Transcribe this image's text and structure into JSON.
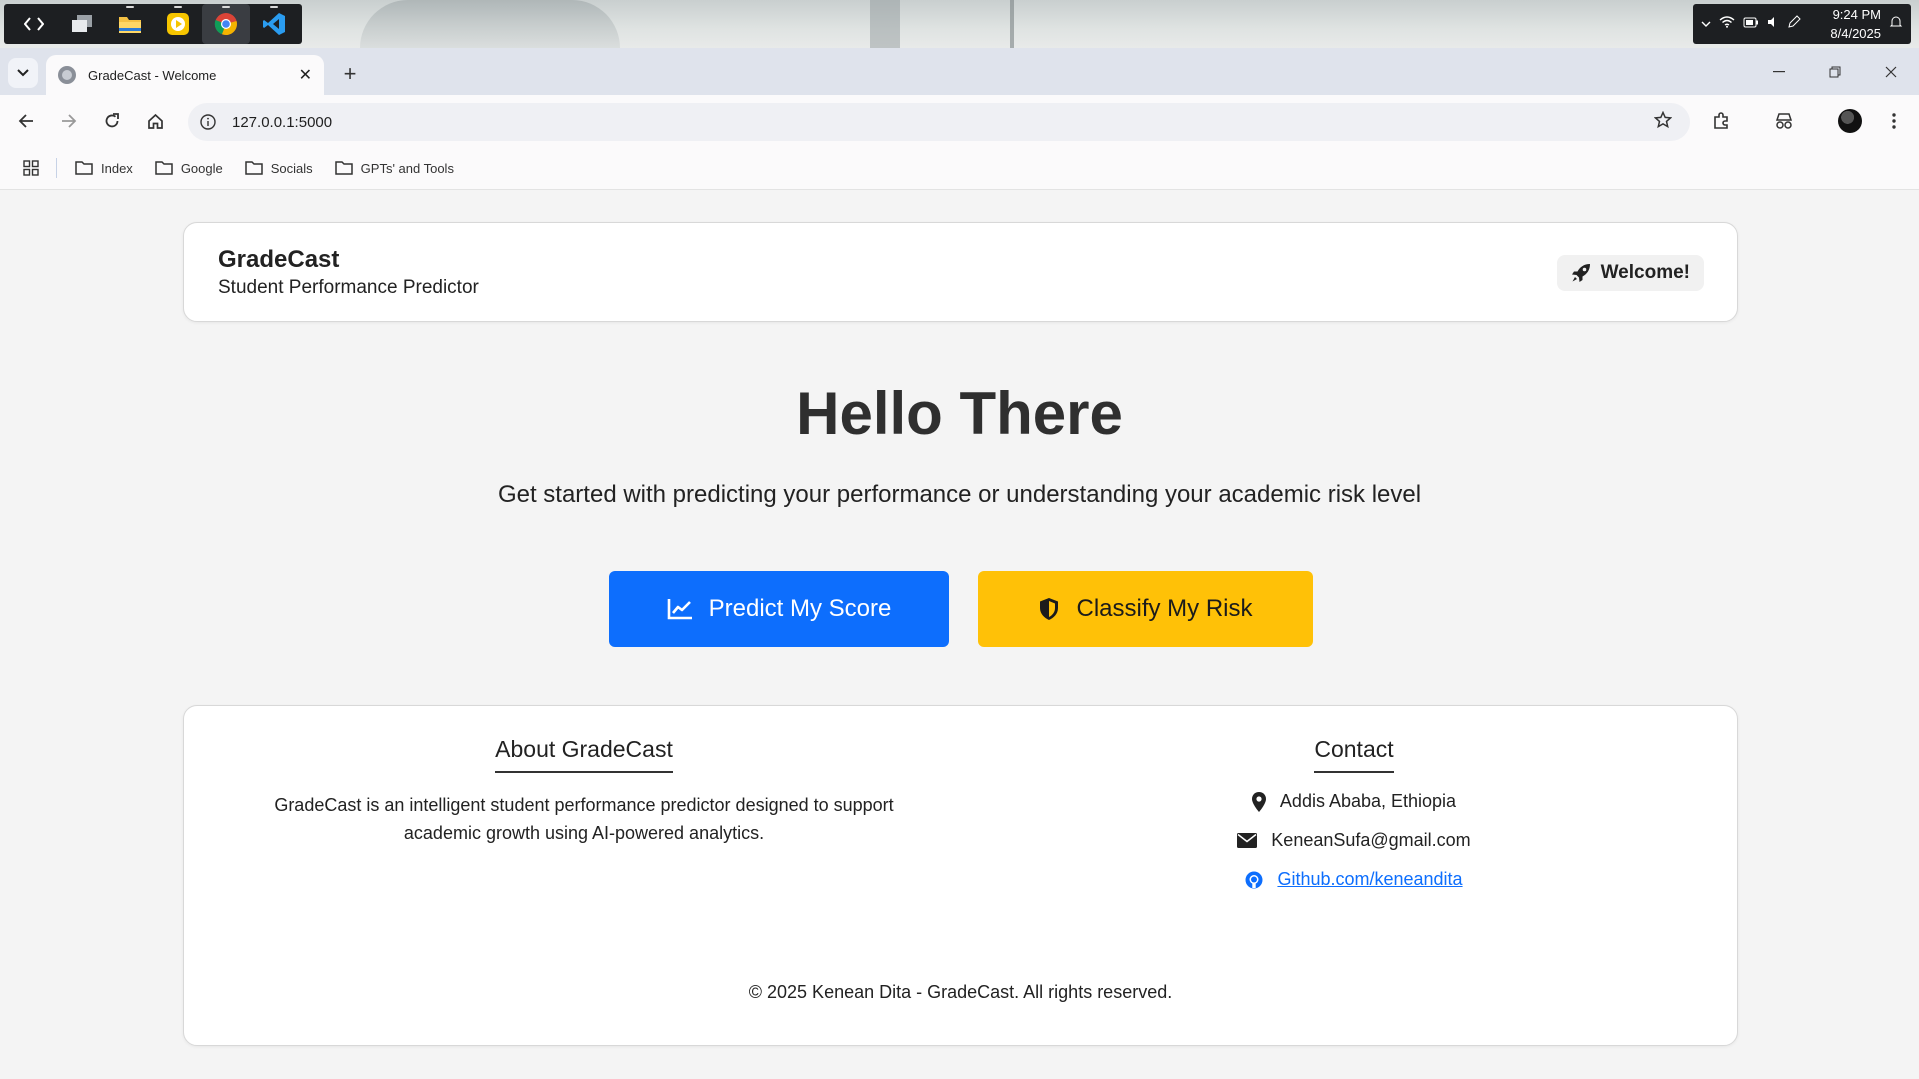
{
  "os": {
    "taskbar_apps": [
      "dev-tools-icon",
      "task-view-icon",
      "file-explorer-icon",
      "media-player-icon",
      "chrome-icon",
      "vscode-icon"
    ],
    "clock_time": "9:24 PM",
    "clock_date": "8/4/2025"
  },
  "browser": {
    "tab_title": "GradeCast - Welcome",
    "url": "127.0.0.1:5000",
    "bookmarks": [
      "Index",
      "Google",
      "Socials",
      "GPTs' and Tools"
    ]
  },
  "header": {
    "brand": "GradeCast",
    "subtitle": "Student Performance Predictor",
    "badge": "Welcome!"
  },
  "hero": {
    "title": "Hello There",
    "subtitle": "Get started with predicting your performance or understanding your academic risk level",
    "predict_label": "Predict My Score",
    "risk_label": "Classify My Risk"
  },
  "footer": {
    "about_title": "About GradeCast",
    "about_text": "GradeCast is an intelligent student performance predictor designed to support academic growth using AI-powered analytics.",
    "contact_title": "Contact",
    "location": "Addis Ababa, Ethiopia",
    "email": "KeneanSufa@gmail.com",
    "github": " Github.com/keneandita",
    "copyright": "© 2025 Kenean Dita - GradeCast. All rights reserved."
  },
  "colors": {
    "primary": "#0d6efd",
    "warning": "#ffc107",
    "page_bg": "#f4f4f4"
  }
}
